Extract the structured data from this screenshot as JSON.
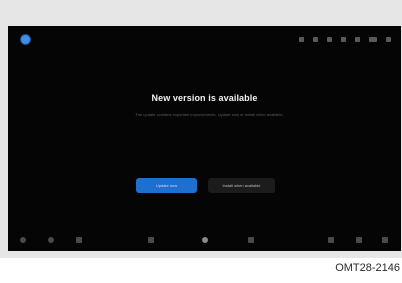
{
  "dialog": {
    "title": "New version is available",
    "body": "The update contains important improvements. Update now or install when available.",
    "primary_label": "Update now",
    "secondary_label": "Install when available"
  },
  "status_bar": {
    "icons": [
      "bluetooth-icon",
      "wifi-icon",
      "signal-icon",
      "sound-icon",
      "battery-icon",
      "time-icon",
      "settings-icon"
    ]
  },
  "dock": {
    "icons": [
      "power-icon",
      "media-icon",
      "phone-icon",
      "climate-icon",
      "home-icon",
      "apps-icon",
      "seat-icon",
      "fan-icon",
      "menu-icon"
    ]
  },
  "caption": "OMT28-2146",
  "colors": {
    "screen_bg": "#050505",
    "accent": "#1f6fd0",
    "app_dot": "#3e8fe6"
  }
}
